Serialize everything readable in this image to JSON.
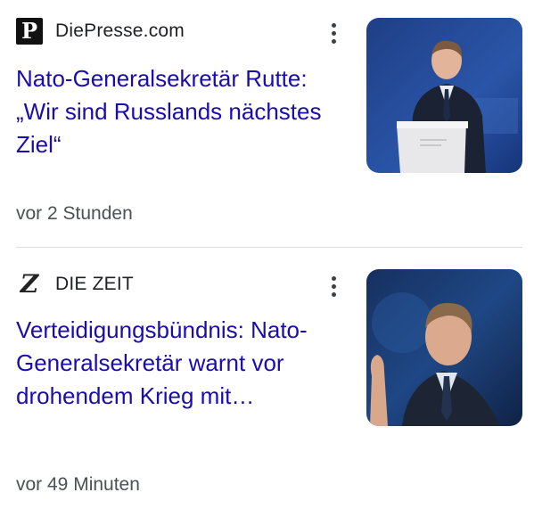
{
  "items": [
    {
      "source_logo": "P",
      "source": "DiePresse.com",
      "headline": "Nato-Generalsekretär Rutte: „Wir sind Russlands nächstes Ziel“",
      "time": "vor 2 Stunden",
      "menu_icon": "more-vert-icon"
    },
    {
      "source_logo": "Z",
      "source": "DIE ZEIT",
      "headline": "Verteidigungsbündnis: Nato-Generalsekretär warnt vor drohendem Krieg mit…",
      "time": "vor 49 Minuten",
      "menu_icon": "more-vert-icon"
    }
  ],
  "colors": {
    "headline": "#1a0dab",
    "meta": "#4d5156",
    "divider": "#dadce0"
  }
}
